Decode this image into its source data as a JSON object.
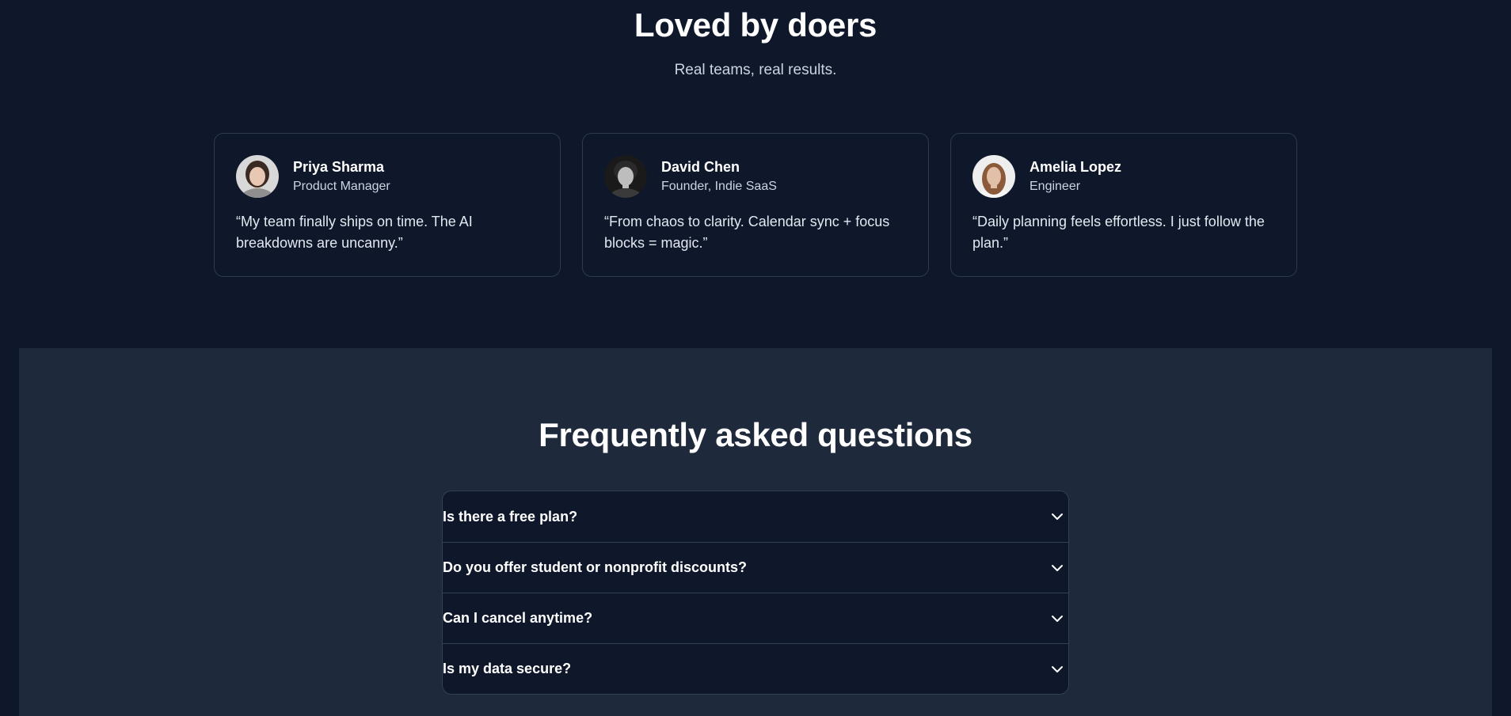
{
  "testimonials": {
    "title": "Loved by doers",
    "subtitle": "Real teams, real results.",
    "cards": [
      {
        "name": "Priya Sharma",
        "role": "Product Manager",
        "quote": "“My team finally ships on time. The AI breakdowns are uncanny.”",
        "avatar_bg": "#d8d8d8",
        "hair": "#3a2a22",
        "skin": "#e8c7b3",
        "shirt": "#8f8f8f"
      },
      {
        "name": "David Chen",
        "role": "Founder, Indie SaaS",
        "quote": "“From chaos to clarity. Calendar sync + focus blocks = magic.”",
        "avatar_bg": "#1a1a1a",
        "hair": "#2a2a2a",
        "skin": "#bdbdbd",
        "shirt": "#3a3a3a"
      },
      {
        "name": "Amelia Lopez",
        "role": "Engineer",
        "quote": "“Daily planning feels effortless. I just follow the plan.”",
        "avatar_bg": "#eeeeee",
        "hair": "#8a5a3a",
        "skin": "#e2bfa8",
        "shirt": "#f5f5f5"
      }
    ]
  },
  "faq": {
    "title": "Frequently asked questions",
    "items": [
      {
        "question": "Is there a free plan?",
        "icon": "chevron-down-icon"
      },
      {
        "question": "Do you offer student or nonprofit discounts?",
        "icon": "chevron-down-icon"
      },
      {
        "question": "Can I cancel anytime?",
        "icon": "chevron-down-icon"
      },
      {
        "question": "Is my data secure?",
        "icon": "chevron-down-icon"
      }
    ]
  },
  "colors": {
    "page_bg": "#0f172a",
    "faq_bg": "#1e293b",
    "border": "#334155",
    "text": "#ffffff",
    "muted": "#cbd5e1"
  }
}
